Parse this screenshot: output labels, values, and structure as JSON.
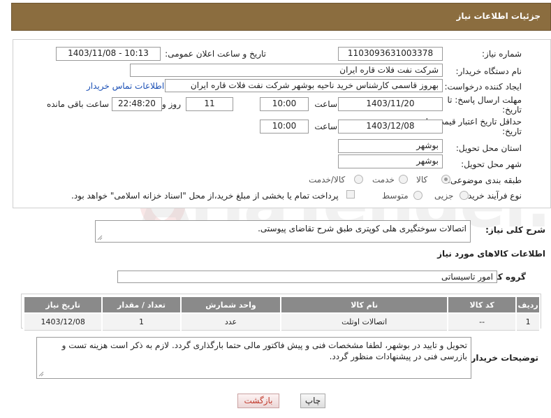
{
  "header": {
    "title": "جزئیات اطلاعات نیاز"
  },
  "form": {
    "need_number_label": "شماره نیاز:",
    "need_number": "1103093631003378",
    "announce_label": "تاریخ و ساعت اعلان عمومی:",
    "announce_value": "1403/11/08 - 10:13",
    "buyer_org_label": "نام دستگاه خریدار:",
    "buyer_org": "شرکت نفت فلات قاره ایران",
    "creator_label": "ایجاد کننده درخواست:",
    "creator": "بهروز قاسمی کارشناس خرید ناحیه بوشهر شرکت نفت فلات قاره ایران",
    "contact_link": "اطلاعات تماس خریدار",
    "deadline_label_1": "مهلت ارسال پاسخ: تا",
    "deadline_label_2": "تاریخ:",
    "deadline_date": "1403/11/20",
    "time_label": "ساعت",
    "deadline_time": "10:00",
    "days_value": "11",
    "days_label": "روز و",
    "remaining_time": "22:48:20",
    "remaining_label": "ساعت باقی مانده",
    "price_validity_label_1": "حداقل تاریخ اعتبار قیمت: تا",
    "price_validity_label_2": "تاریخ:",
    "price_validity_date": "1403/12/08",
    "price_validity_time": "10:00",
    "province_label": "استان محل تحویل:",
    "province": "بوشهر",
    "city_label": "شهر محل تحویل:",
    "city": "بوشهر",
    "category_label": "طبقه بندی موضوعی:",
    "category_options": [
      "کالا",
      "خدمت",
      "کالا/خدمت"
    ],
    "category_selected": "کالا",
    "process_label": "نوع فرآیند خرید :",
    "process_options": [
      "جزیی",
      "متوسط"
    ],
    "process_selected": "",
    "payment_note": "پرداخت تمام یا بخشی از مبلغ خرید،از محل \"اسناد خزانه اسلامی\" خواهد بود."
  },
  "description": {
    "label": "شرح کلی نیاز:",
    "value": "اتصالات سوختگیری هلی کوپتری طبق شرح تقاضای پیوستی."
  },
  "goods_section": {
    "title": "اطلاعات کالاهای مورد نیاز",
    "group_label": "گروه کالا:",
    "group_value": "امور تاسیساتی"
  },
  "table": {
    "headers": [
      "ردیف",
      "کد کالا",
      "نام کالا",
      "واحد شمارش",
      "تعداد / مقدار",
      "تاریخ نیاز"
    ],
    "rows": [
      [
        "1",
        "--",
        "اتصالات اوتلت",
        "عدد",
        "1",
        "1403/12/08"
      ]
    ]
  },
  "buyer_notes": {
    "label": "توضیحات خریدار:",
    "value": "تحویل و تایید در بوشهر، لطفا مشخصات فنی  و پیش فاکتور مالی حتما بارگذاری گردد. لازم به ذکر است هزینه تست و بازرسی فنی در پیشنهادات منظور گردد."
  },
  "buttons": {
    "print": "چاپ",
    "back": "بازگشت"
  },
  "watermark": "AriaTender.net",
  "colors": {
    "header_bg": "#8b6d3f",
    "link": "#1a4fb5",
    "table_header": "#8a8a8a",
    "back_text": "#c0392b"
  }
}
